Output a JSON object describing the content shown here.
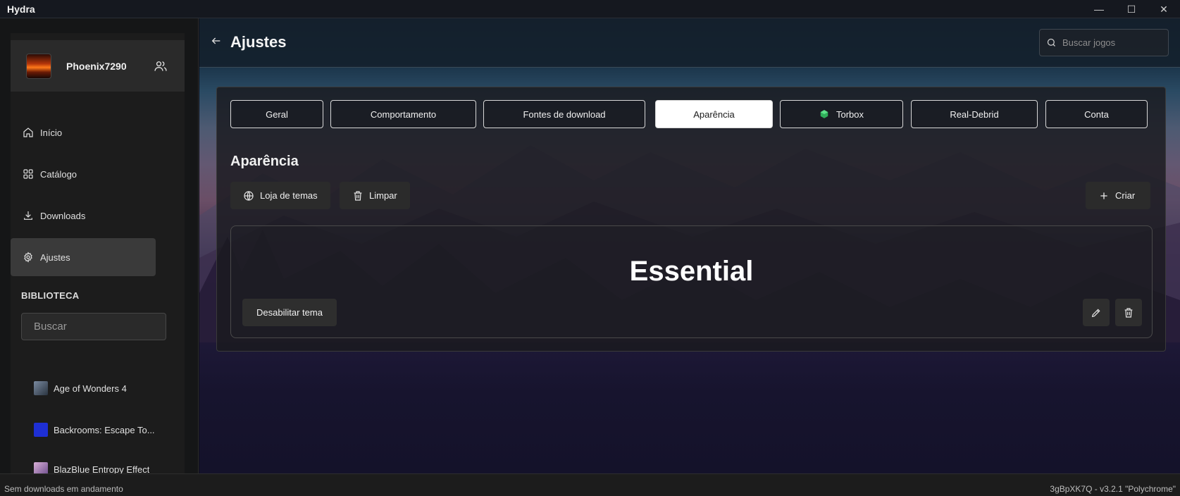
{
  "app": {
    "title": "Hydra"
  },
  "window_controls": {
    "minimize": "—",
    "maximize": "☐",
    "close": "✕"
  },
  "sidebar": {
    "profile": {
      "name": "Phoenix7290"
    },
    "nav": [
      {
        "label": "Início",
        "icon": "home-icon"
      },
      {
        "label": "Catálogo",
        "icon": "grid-icon"
      },
      {
        "label": "Downloads",
        "icon": "download-icon"
      },
      {
        "label": "Ajustes",
        "icon": "gear-icon",
        "active": true
      }
    ],
    "library": {
      "title": "BIBLIOTECA",
      "search_placeholder": "Buscar",
      "games": [
        {
          "name": "Age of Wonders 4"
        },
        {
          "name": "Backrooms: Escape To..."
        },
        {
          "name": "BlazBlue Entropy Effect"
        }
      ]
    }
  },
  "header": {
    "title": "Ajustes",
    "search_placeholder": "Buscar jogos"
  },
  "tabs": [
    {
      "label": "Geral"
    },
    {
      "label": "Comportamento"
    },
    {
      "label": "Fontes de download"
    },
    {
      "label": "Aparência",
      "active": true
    },
    {
      "label": "Torbox"
    },
    {
      "label": "Real-Debrid"
    },
    {
      "label": "Conta"
    }
  ],
  "appearance": {
    "title": "Aparência",
    "theme_store_label": "Loja de temas",
    "clear_label": "Limpar",
    "create_label": "Criar",
    "theme": {
      "name": "Essential",
      "disable_label": "Desabilitar tema"
    }
  },
  "status": {
    "left": "Sem downloads em andamento",
    "right": "3gBpXK7Q - v3.2.1 \"Polychrome\""
  },
  "colors": {
    "accent_active_tab": "#ffffff",
    "sidebar_active": "#3a3a3a"
  }
}
